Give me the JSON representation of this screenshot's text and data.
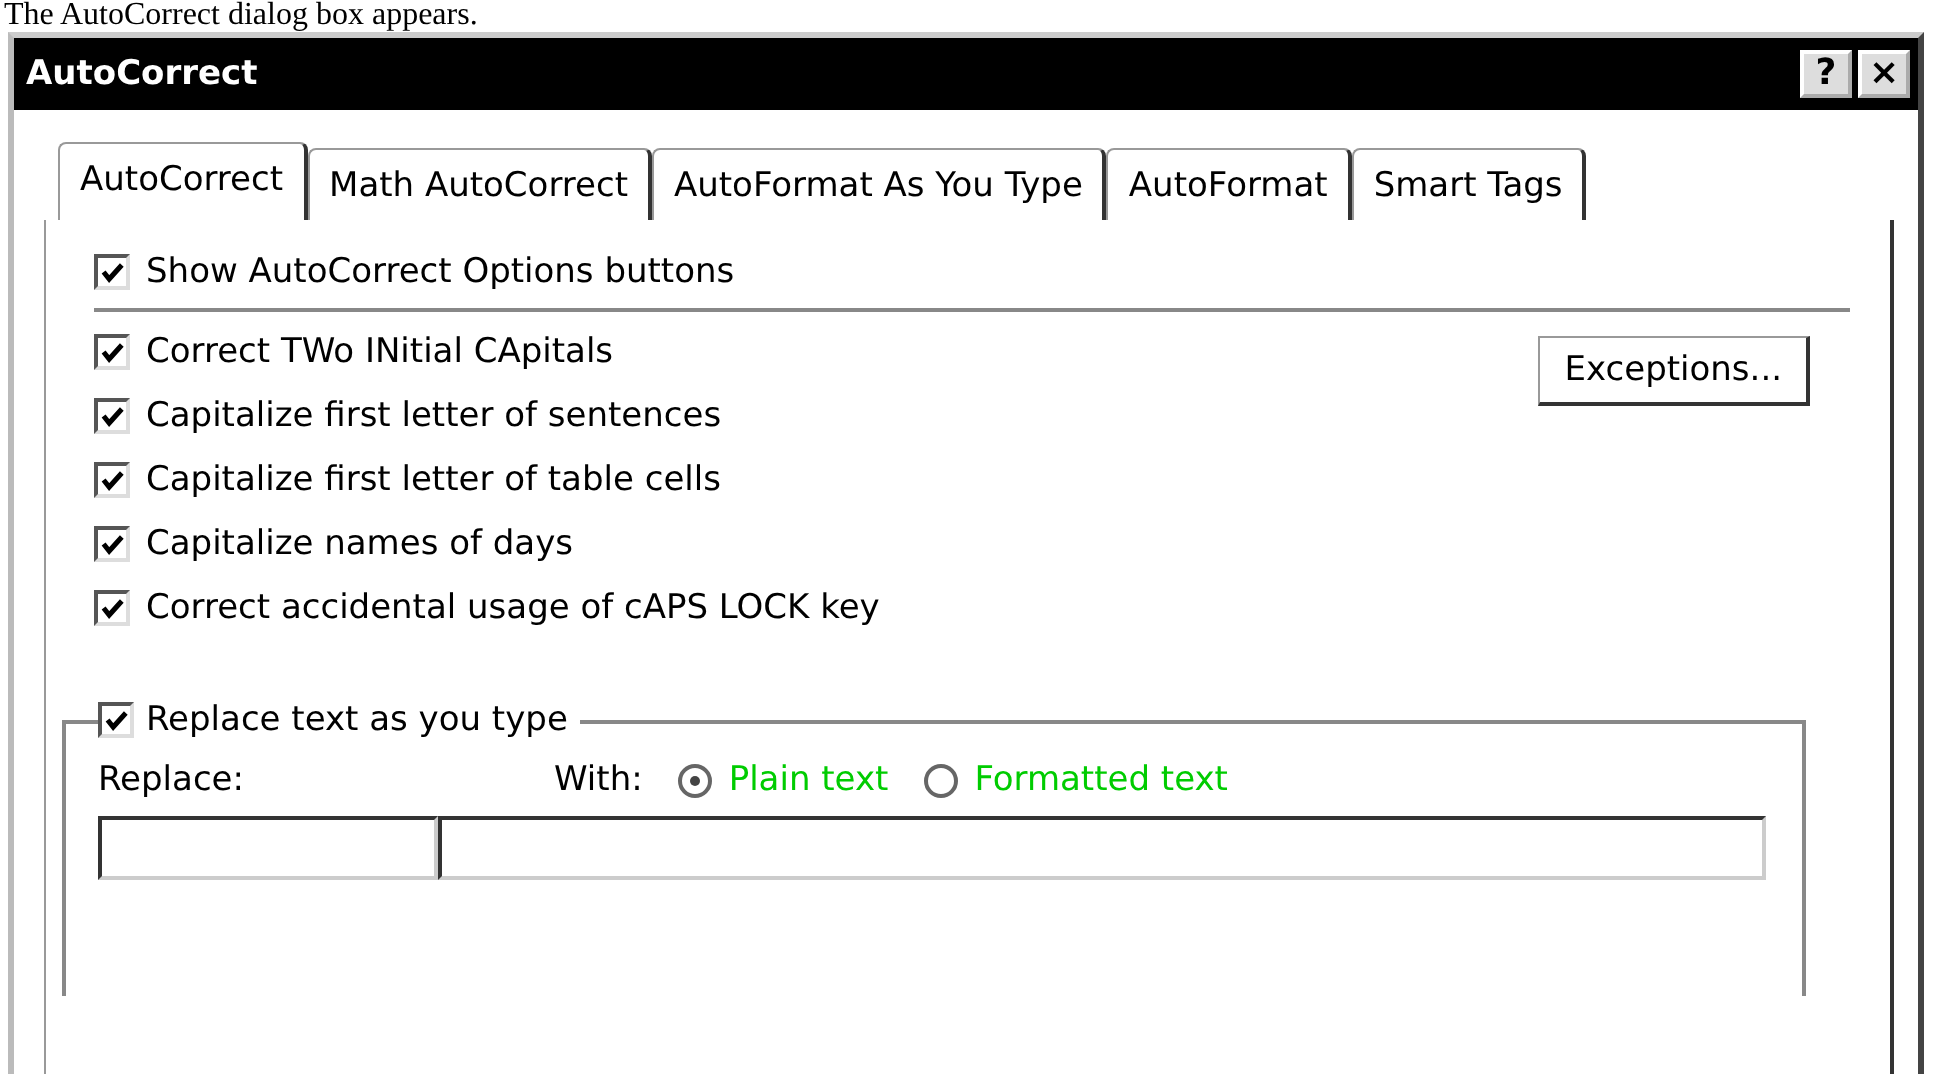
{
  "caption": "The AutoCorrect dialog box appears.",
  "window": {
    "title": "AutoCorrect",
    "help_button": "?",
    "close_button": "×"
  },
  "tabs": [
    {
      "label": "AutoCorrect",
      "selected": true
    },
    {
      "label": "Math AutoCorrect",
      "selected": false
    },
    {
      "label": "AutoFormat As You Type",
      "selected": false
    },
    {
      "label": "AutoFormat",
      "selected": false
    },
    {
      "label": "Smart Tags",
      "selected": false
    }
  ],
  "top_option": {
    "label": "Show AutoCorrect Options buttons",
    "checked": true
  },
  "options": [
    {
      "label": "Correct TWo INitial CApitals",
      "checked": true
    },
    {
      "label": "Capitalize first letter of sentences",
      "checked": true
    },
    {
      "label": "Capitalize first letter of table cells",
      "checked": true
    },
    {
      "label": "Capitalize names of days",
      "checked": true
    },
    {
      "label": "Correct accidental usage of cAPS LOCK key",
      "checked": true
    }
  ],
  "exceptions_button": "Exceptions...",
  "replace_group": {
    "label": "Replace text as you type",
    "checked": true,
    "replace_label": "Replace:",
    "with_label": "With:",
    "formats": [
      {
        "label": "Plain text",
        "selected": true
      },
      {
        "label": "Formatted text",
        "selected": false
      }
    ]
  }
}
